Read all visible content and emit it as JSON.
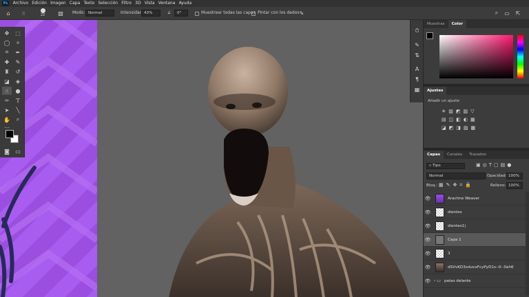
{
  "menu": [
    "Archivo",
    "Edición",
    "Imagen",
    "Capa",
    "Texto",
    "Selección",
    "Filtro",
    "3D",
    "Vista",
    "Ventana",
    "Ayuda"
  ],
  "app_logo": "Ps",
  "options": {
    "brush_size": "22",
    "mode_label": "Modo:",
    "mode_value": "Normal",
    "intensity_label": "Intensidad:",
    "intensity_value": "43%",
    "angle_value": "0°",
    "sample_all_label": "Muestrear todas las capas",
    "finger_paint_label": "Pintar con los dedos"
  },
  "panels": {
    "top_tabs": [
      "Muestras",
      "Color"
    ],
    "active_top_tab": "Color",
    "adjustments_title": "Ajustes",
    "add_adjustment": "Añadir un ajuste",
    "layer_tabs": [
      "Capas",
      "Canales",
      "Trazados"
    ],
    "filter_kind": "Tipo",
    "blend_mode": "Normal",
    "opacity_label": "Opacidad:",
    "opacity_value": "100%",
    "lock_label": "Bloq.:",
    "fill_label": "Relleno:",
    "fill_value": "100%"
  },
  "layers": [
    {
      "name": "Arachne Weaver",
      "selected": false
    },
    {
      "name": "dientes",
      "selected": false
    },
    {
      "name": "dientes1|",
      "selected": false
    },
    {
      "name": "Capa 1",
      "selected": true
    },
    {
      "name": "3",
      "selected": false
    },
    {
      "name": "dSVvKD3xduvxFcyPyD1s--0--0ah6",
      "selected": false
    },
    {
      "name": "patas delante",
      "selected": false
    }
  ],
  "colors": {
    "fg": "#000000",
    "bg": "#ffffff",
    "canvas_bg": "#626262",
    "purple": "#a95cf0",
    "selected_layer": "#595959"
  },
  "icons": [
    "home-icon",
    "brush-icon",
    "search-icon",
    "workspace-icon",
    "expand-icon",
    "eye-icon"
  ]
}
